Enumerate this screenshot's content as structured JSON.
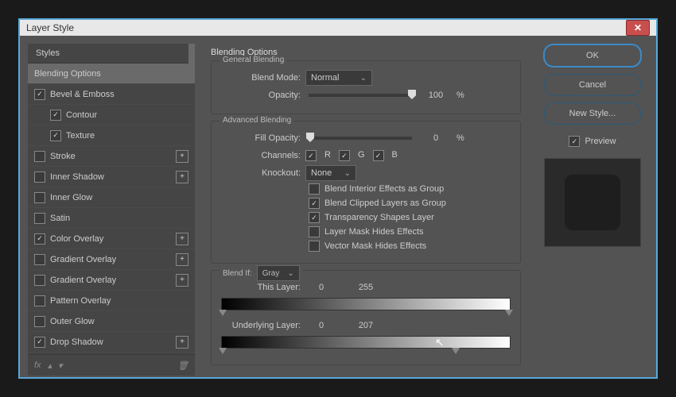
{
  "title": "Layer Style",
  "sidebar": {
    "header": "Styles",
    "items": [
      {
        "label": "Blending Options",
        "checked": null,
        "plus": false,
        "sel": true,
        "sub": false
      },
      {
        "label": "Bevel & Emboss",
        "checked": true,
        "plus": false,
        "sel": false,
        "sub": false
      },
      {
        "label": "Contour",
        "checked": true,
        "plus": false,
        "sel": false,
        "sub": true
      },
      {
        "label": "Texture",
        "checked": true,
        "plus": false,
        "sel": false,
        "sub": true
      },
      {
        "label": "Stroke",
        "checked": false,
        "plus": true,
        "sel": false,
        "sub": false
      },
      {
        "label": "Inner Shadow",
        "checked": false,
        "plus": true,
        "sel": false,
        "sub": false
      },
      {
        "label": "Inner Glow",
        "checked": false,
        "plus": false,
        "sel": false,
        "sub": false
      },
      {
        "label": "Satin",
        "checked": false,
        "plus": false,
        "sel": false,
        "sub": false
      },
      {
        "label": "Color Overlay",
        "checked": true,
        "plus": true,
        "sel": false,
        "sub": false
      },
      {
        "label": "Gradient Overlay",
        "checked": false,
        "plus": true,
        "sel": false,
        "sub": false
      },
      {
        "label": "Gradient Overlay",
        "checked": false,
        "plus": true,
        "sel": false,
        "sub": false
      },
      {
        "label": "Pattern Overlay",
        "checked": false,
        "plus": false,
        "sel": false,
        "sub": false
      },
      {
        "label": "Outer Glow",
        "checked": false,
        "plus": false,
        "sel": false,
        "sub": false
      },
      {
        "label": "Drop Shadow",
        "checked": true,
        "plus": true,
        "sel": false,
        "sub": false
      }
    ],
    "footer_fx": "fx"
  },
  "main": {
    "heading": "Blending Options",
    "general": {
      "legend": "General Blending",
      "blend_mode_label": "Blend Mode:",
      "blend_mode_value": "Normal",
      "opacity_label": "Opacity:",
      "opacity_value": "100",
      "opacity_unit": "%"
    },
    "advanced": {
      "legend": "Advanced Blending",
      "fill_label": "Fill Opacity:",
      "fill_value": "0",
      "fill_unit": "%",
      "channels_label": "Channels:",
      "ch_r": "R",
      "ch_g": "G",
      "ch_b": "B",
      "knockout_label": "Knockout:",
      "knockout_value": "None",
      "opt1": "Blend Interior Effects as Group",
      "opt2": "Blend Clipped Layers as Group",
      "opt3": "Transparency Shapes Layer",
      "opt4": "Layer Mask Hides Effects",
      "opt5": "Vector Mask Hides Effects"
    },
    "blendif": {
      "legend_label": "Blend If:",
      "legend_value": "Gray",
      "this_label": "This Layer:",
      "this_lo": "0",
      "this_hi": "255",
      "under_label": "Underlying Layer:",
      "under_lo": "0",
      "under_hi": "207"
    }
  },
  "right": {
    "ok": "OK",
    "cancel": "Cancel",
    "newstyle": "New Style...",
    "preview": "Preview"
  }
}
